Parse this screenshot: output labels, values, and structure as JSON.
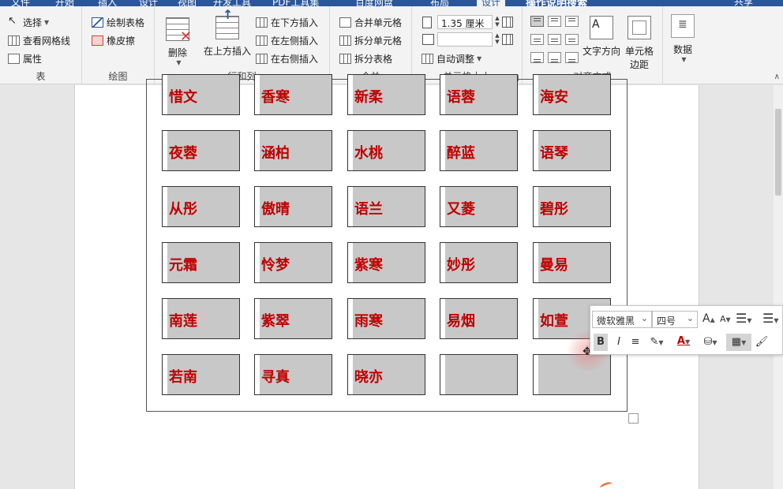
{
  "tabs": {
    "items": [
      "文件",
      "开始",
      "插入",
      "设计",
      "视图",
      "开发工具",
      "PDF工具集",
      "百度网盘",
      "布局",
      "设计"
    ],
    "active": "设计",
    "tell_me": "操作说明搜索",
    "user": "共享"
  },
  "ribbon": {
    "table": {
      "label": "表",
      "select": "选择",
      "view_gridlines": "查看网格线",
      "properties": "属性"
    },
    "draw": {
      "label": "绘图",
      "draw_table": "绘制表格",
      "eraser": "橡皮擦"
    },
    "rows_cols": {
      "label": "行和列",
      "delete": "删除",
      "insert_above": "在上方插入",
      "insert_below": "在下方插入",
      "insert_left": "在左侧插入",
      "insert_right": "在右侧插入"
    },
    "merge": {
      "label": "合并",
      "merge_cells": "合并单元格",
      "split_cells": "拆分单元格",
      "split_table": "拆分表格"
    },
    "cell_size": {
      "label": "单元格大小",
      "height": "1.35 厘米",
      "width": "",
      "autofit": "自动调整"
    },
    "alignment": {
      "label": "对齐方式",
      "text_direction": "文字方向",
      "cell_margins_line1": "单元格",
      "cell_margins_line2": "边距"
    },
    "data": {
      "label": "数据"
    }
  },
  "grid": [
    [
      "惜文",
      "香寒",
      "新柔",
      "语蓉",
      "海安"
    ],
    [
      "夜蓉",
      "涵柏",
      "水桃",
      "醉蓝",
      "语琴"
    ],
    [
      "从彤",
      "傲晴",
      "语兰",
      "又菱",
      "碧彤"
    ],
    [
      "元霜",
      "怜梦",
      "紫寒",
      "妙彤",
      "曼易"
    ],
    [
      "南莲",
      "紫翠",
      "雨寒",
      "易烟",
      "如萱"
    ],
    [
      "若南",
      "寻真",
      "晓亦",
      "",
      ""
    ]
  ],
  "mini_toolbar": {
    "font": "微软雅黑",
    "size": "四号",
    "grow": "A",
    "shrink": "A",
    "bold": "B",
    "italic": "I",
    "font_color_letter": "A"
  },
  "colors": {
    "ribbon_blue": "#2b579a",
    "cell_text": "#c00000",
    "cell_fill": "#c8c8c8"
  }
}
